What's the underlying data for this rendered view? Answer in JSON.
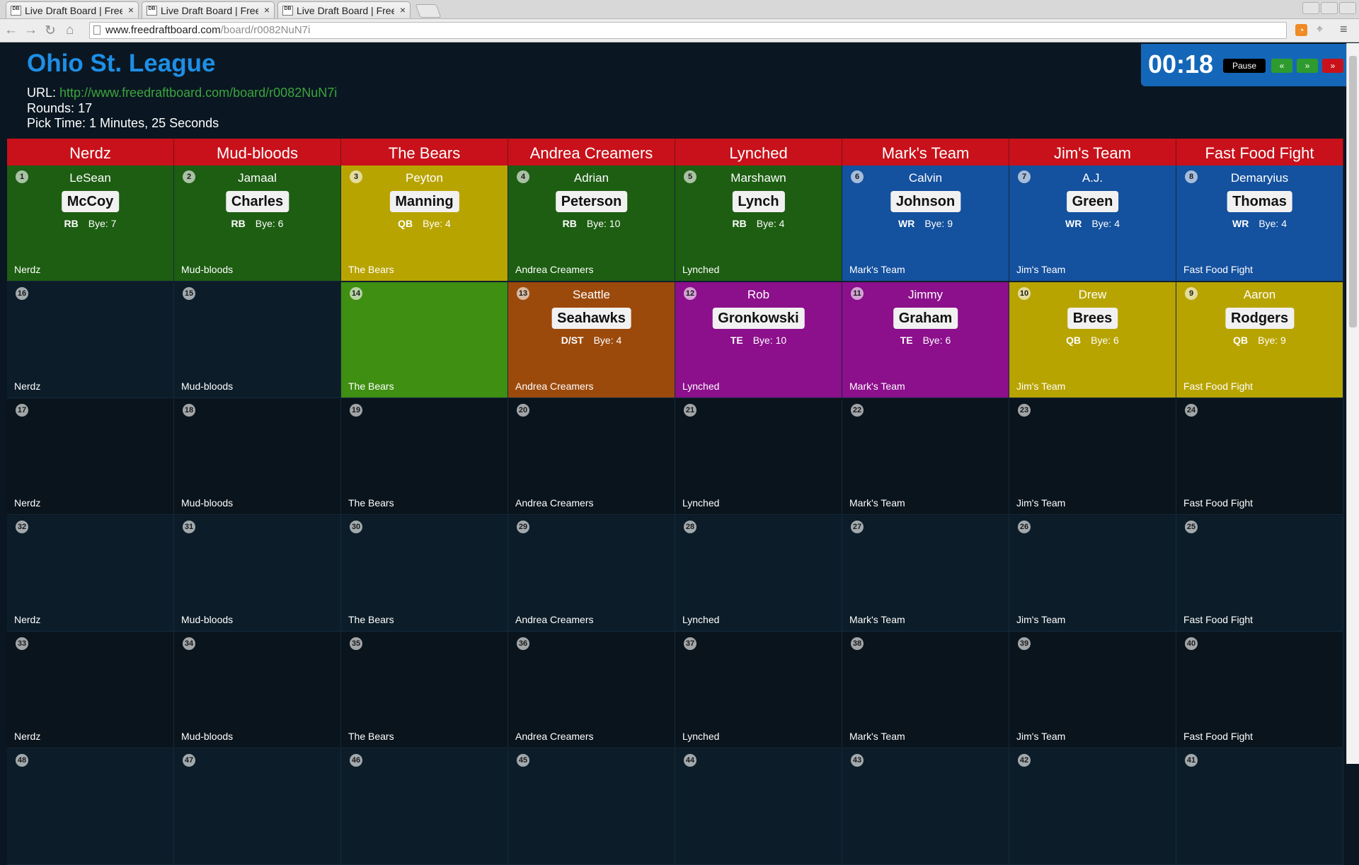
{
  "browser": {
    "tabs": [
      {
        "title": "Live Draft Board | Free",
        "favicon": "DB"
      },
      {
        "title": "Live Draft Board | Free",
        "favicon": "DB"
      },
      {
        "title": "Live Draft Board | Free",
        "favicon": "DB"
      }
    ],
    "close_glyph": "×",
    "url_domain": "www.freedraftboard.com",
    "url_path": "/board/r0082NuN7i"
  },
  "league": {
    "title": "Ohio St. League",
    "url_label": "URL:",
    "url": "http://www.freedraftboard.com/board/r0082NuN7i",
    "rounds_label": "Rounds:",
    "rounds": "17",
    "pick_time_label": "Pick Time:",
    "pick_time": "1 Minutes, 25 Seconds"
  },
  "timer": {
    "time": "00:18",
    "pause_label": "Pause",
    "prev_label": "«",
    "next_label": "»",
    "end_label": "»"
  },
  "colors": {
    "header": "#c8111a",
    "RB": "#1d5e12",
    "QB": "#b8a400",
    "WR": "#14519e",
    "TE": "#8c0f8c",
    "DST": "#9c4a0c",
    "on_clock": "#3f8f12",
    "empty_dark": "#0a141c",
    "empty_light": "#0c1d29",
    "accent": "#1467b8"
  },
  "teams": [
    "Nerdz",
    "Mud-bloods",
    "The Bears",
    "Andrea Creamers",
    "Lynched",
    "Mark's Team",
    "Jim's Team",
    "Fast Food Fight"
  ],
  "rounds": [
    {
      "shade": "pick",
      "cells": [
        {
          "num": "1",
          "first": "LeSean",
          "last": "McCoy",
          "pos": "RB",
          "bye": "Bye: 7",
          "color": "RB",
          "owner": "Nerdz"
        },
        {
          "num": "2",
          "first": "Jamaal",
          "last": "Charles",
          "pos": "RB",
          "bye": "Bye: 6",
          "color": "RB",
          "owner": "Mud-bloods"
        },
        {
          "num": "3",
          "first": "Peyton",
          "last": "Manning",
          "pos": "QB",
          "bye": "Bye: 4",
          "color": "QB",
          "owner": "The Bears"
        },
        {
          "num": "4",
          "first": "Adrian",
          "last": "Peterson",
          "pos": "RB",
          "bye": "Bye: 10",
          "color": "RB",
          "owner": "Andrea Creamers"
        },
        {
          "num": "5",
          "first": "Marshawn",
          "last": "Lynch",
          "pos": "RB",
          "bye": "Bye: 4",
          "color": "RB",
          "owner": "Lynched"
        },
        {
          "num": "6",
          "first": "Calvin",
          "last": "Johnson",
          "pos": "WR",
          "bye": "Bye: 9",
          "color": "WR",
          "owner": "Mark's Team"
        },
        {
          "num": "7",
          "first": "A.J.",
          "last": "Green",
          "pos": "WR",
          "bye": "Bye: 4",
          "color": "WR",
          "owner": "Jim's Team"
        },
        {
          "num": "8",
          "first": "Demaryius",
          "last": "Thomas",
          "pos": "WR",
          "bye": "Bye: 4",
          "color": "WR",
          "owner": "Fast Food Fight"
        }
      ]
    },
    {
      "shade": "empty_light",
      "cells": [
        {
          "num": "16",
          "owner": "Nerdz"
        },
        {
          "num": "15",
          "owner": "Mud-bloods"
        },
        {
          "num": "14",
          "color": "on_clock",
          "owner": "The Bears"
        },
        {
          "num": "13",
          "first": "Seattle",
          "last": "Seahawks",
          "pos": "D/ST",
          "bye": "Bye: 4",
          "color": "DST",
          "owner": "Andrea Creamers"
        },
        {
          "num": "12",
          "first": "Rob",
          "last": "Gronkowski",
          "pos": "TE",
          "bye": "Bye: 10",
          "color": "TE",
          "owner": "Lynched"
        },
        {
          "num": "11",
          "first": "Jimmy",
          "last": "Graham",
          "pos": "TE",
          "bye": "Bye: 6",
          "color": "TE",
          "owner": "Mark's Team"
        },
        {
          "num": "10",
          "first": "Drew",
          "last": "Brees",
          "pos": "QB",
          "bye": "Bye: 6",
          "color": "QB",
          "owner": "Jim's Team"
        },
        {
          "num": "9",
          "first": "Aaron",
          "last": "Rodgers",
          "pos": "QB",
          "bye": "Bye: 9",
          "color": "QB",
          "owner": "Fast Food Fight"
        }
      ]
    },
    {
      "shade": "empty_dark",
      "cells": [
        {
          "num": "17",
          "owner": "Nerdz"
        },
        {
          "num": "18",
          "owner": "Mud-bloods"
        },
        {
          "num": "19",
          "owner": "The Bears"
        },
        {
          "num": "20",
          "owner": "Andrea Creamers"
        },
        {
          "num": "21",
          "owner": "Lynched"
        },
        {
          "num": "22",
          "owner": "Mark's Team"
        },
        {
          "num": "23",
          "owner": "Jim's Team"
        },
        {
          "num": "24",
          "owner": "Fast Food Fight"
        }
      ]
    },
    {
      "shade": "empty_light",
      "cells": [
        {
          "num": "32",
          "owner": "Nerdz"
        },
        {
          "num": "31",
          "owner": "Mud-bloods"
        },
        {
          "num": "30",
          "owner": "The Bears"
        },
        {
          "num": "29",
          "owner": "Andrea Creamers"
        },
        {
          "num": "28",
          "owner": "Lynched"
        },
        {
          "num": "27",
          "owner": "Mark's Team"
        },
        {
          "num": "26",
          "owner": "Jim's Team"
        },
        {
          "num": "25",
          "owner": "Fast Food Fight"
        }
      ]
    },
    {
      "shade": "empty_dark",
      "cells": [
        {
          "num": "33",
          "owner": "Nerdz"
        },
        {
          "num": "34",
          "owner": "Mud-bloods"
        },
        {
          "num": "35",
          "owner": "The Bears"
        },
        {
          "num": "36",
          "owner": "Andrea Creamers"
        },
        {
          "num": "37",
          "owner": "Lynched"
        },
        {
          "num": "38",
          "owner": "Mark's Team"
        },
        {
          "num": "39",
          "owner": "Jim's Team"
        },
        {
          "num": "40",
          "owner": "Fast Food Fight"
        }
      ]
    },
    {
      "shade": "empty_light",
      "cells": [
        {
          "num": "48",
          "owner": ""
        },
        {
          "num": "47",
          "owner": ""
        },
        {
          "num": "46",
          "owner": ""
        },
        {
          "num": "45",
          "owner": ""
        },
        {
          "num": "44",
          "owner": ""
        },
        {
          "num": "43",
          "owner": ""
        },
        {
          "num": "42",
          "owner": ""
        },
        {
          "num": "41",
          "owner": ""
        }
      ]
    }
  ]
}
